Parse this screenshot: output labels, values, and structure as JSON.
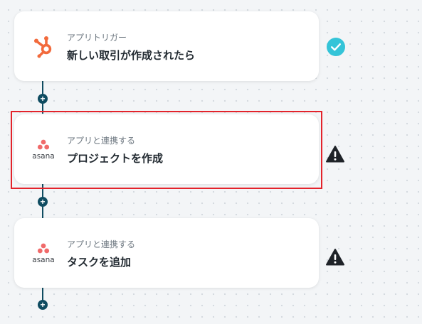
{
  "flow": {
    "steps": [
      {
        "subtitle": "アプリトリガー",
        "title": "新しい取引が作成されたら",
        "app_icon": "hubspot-icon",
        "status_icon": "check-icon",
        "status_color": "#34c4d8"
      },
      {
        "subtitle": "アプリと連携する",
        "title": "プロジェクトを作成",
        "app_icon": "asana-icon",
        "app_name": "asana",
        "status_icon": "warning-icon",
        "status_color": "#1f2328",
        "highlighted": true
      },
      {
        "subtitle": "アプリと連携する",
        "title": "タスクを追加",
        "app_icon": "asana-icon",
        "app_name": "asana",
        "status_icon": "warning-icon",
        "status_color": "#1f2328"
      }
    ],
    "add_label": "+"
  },
  "colors": {
    "connector": "#0f4c61",
    "highlight_border": "#e3232b",
    "hubspot": "#f26a3c",
    "asana": "#f06a6a"
  }
}
